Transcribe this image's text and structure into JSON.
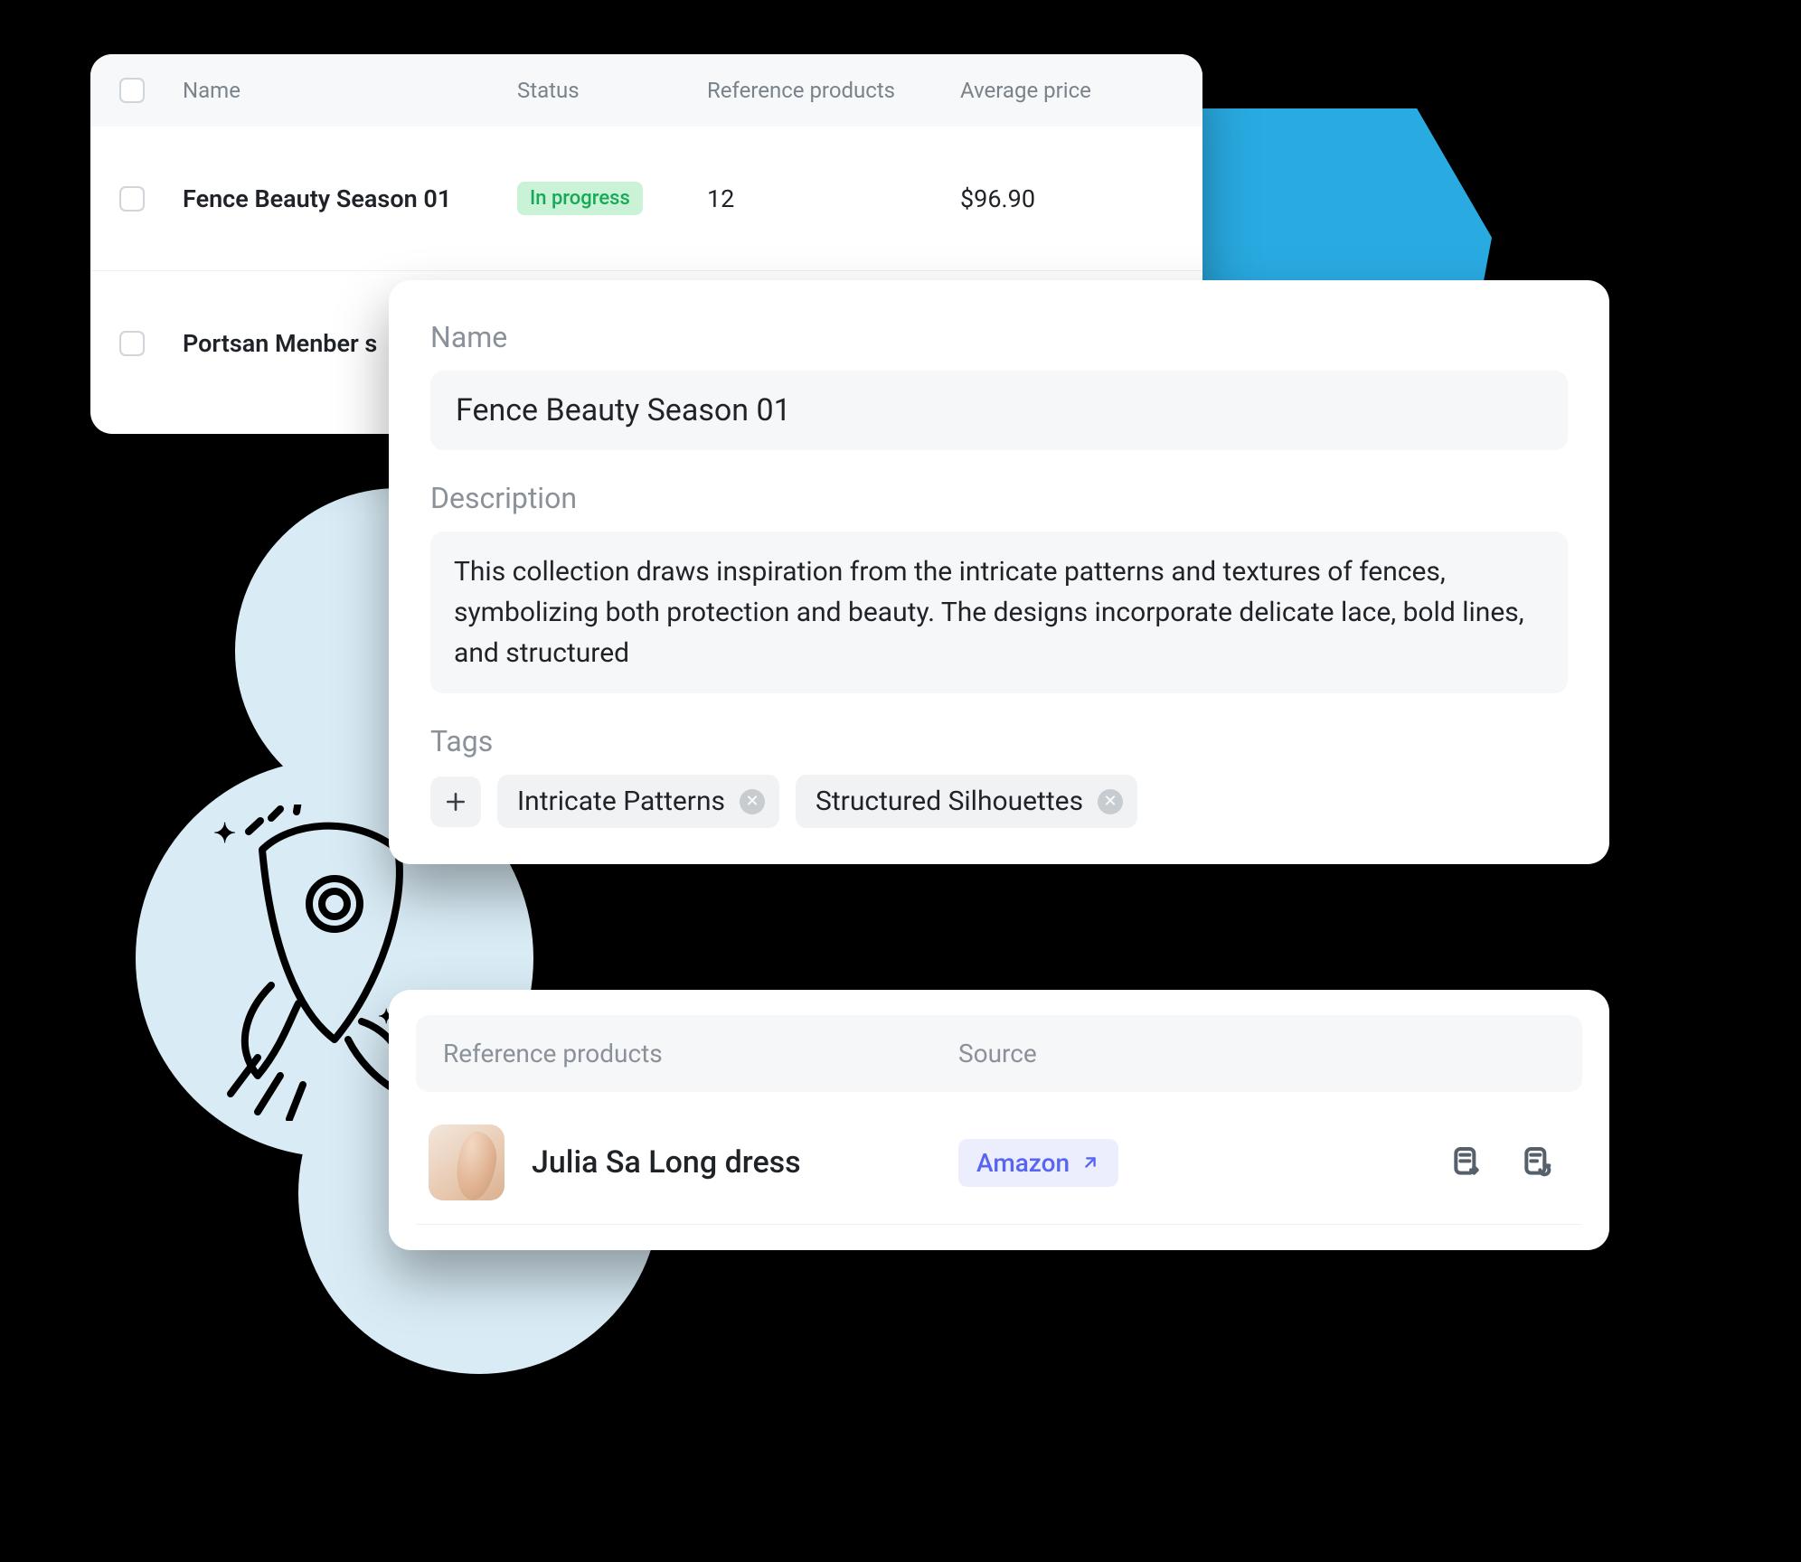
{
  "table": {
    "columns": {
      "name": "Name",
      "status": "Status",
      "reference_products": "Reference products",
      "average_price": "Average price"
    },
    "rows": [
      {
        "name": "Fence Beauty Season 01",
        "status": "In progress",
        "reference_products": "12",
        "average_price": "$96.90"
      },
      {
        "name": "Portsan Menber s",
        "status": "",
        "reference_products": "",
        "average_price": ""
      }
    ]
  },
  "detail": {
    "name_label": "Name",
    "name_value": "Fence Beauty Season 01",
    "description_label": "Description",
    "description_value": "This collection draws inspiration from the intricate patterns and textures of fences, symbolizing both protection and beauty. The designs incorporate delicate lace, bold lines, and structured",
    "tags_label": "Tags",
    "tags": [
      "Intricate Patterns",
      "Structured Silhouettes"
    ]
  },
  "products": {
    "columns": {
      "reference_products": "Reference products",
      "source": "Source"
    },
    "rows": [
      {
        "name": "Julia Sa Long dress",
        "source": "Amazon"
      }
    ]
  }
}
